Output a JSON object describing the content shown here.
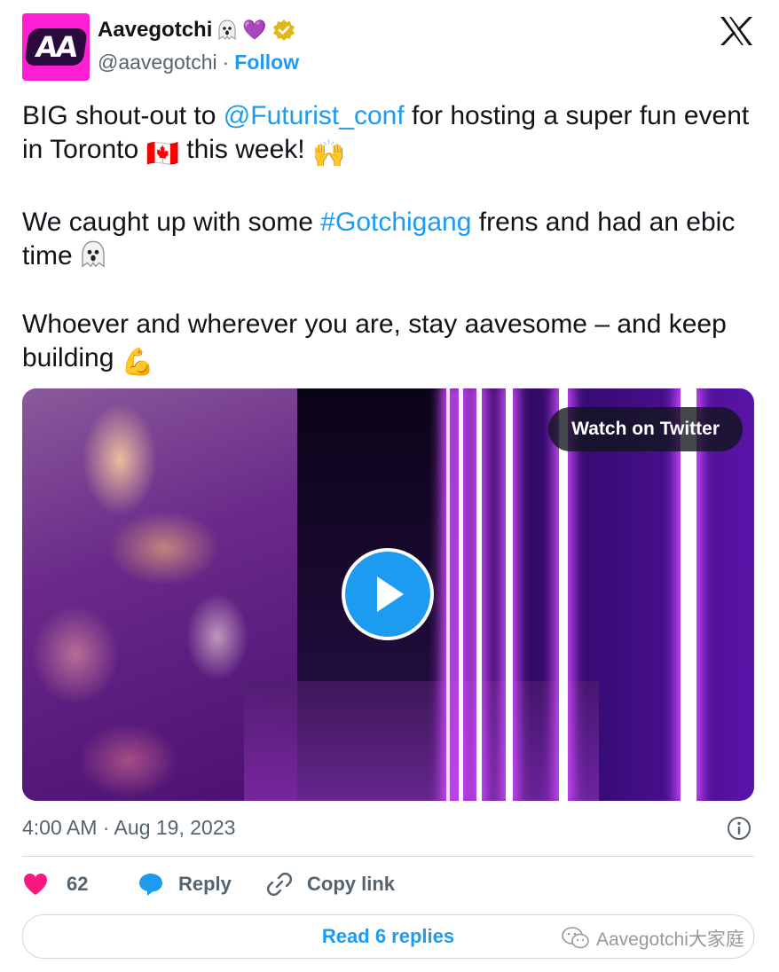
{
  "author": {
    "display_name": "Aavegotchi",
    "name_emojis": "💜",
    "handle": "@aavegotchi",
    "separator": "·",
    "follow_label": "Follow",
    "avatar_text": "AA"
  },
  "tweet": {
    "p1_before": "BIG shout-out to ",
    "p1_mention": "@Futurist_conf",
    "p1_after": " for hosting a super fun event in Toronto ",
    "p1_flag": "🇨🇦",
    "p1_end": " this week! ",
    "p1_emoji": "🙌",
    "p2_before": "We caught up with some ",
    "p2_hashtag": "#Gotchigang",
    "p2_after": " frens and had an ebic time ",
    "p3_text": "Whoever and wherever you are, stay aavesome – and keep building ",
    "p3_emoji": "💪"
  },
  "media": {
    "watch_label": "Watch on Twitter"
  },
  "meta": {
    "timestamp": "4:00 AM · Aug 19, 2023"
  },
  "actions": {
    "like_count": "62",
    "reply_label": "Reply",
    "copy_link_label": "Copy link"
  },
  "footer": {
    "read_replies_label": "Read 6 replies",
    "watermark_text": "Aavegotchi大家庭"
  },
  "colors": {
    "accent": "#1d9bf0",
    "like": "#f91880",
    "text": "#0f1419",
    "muted": "#536471"
  }
}
